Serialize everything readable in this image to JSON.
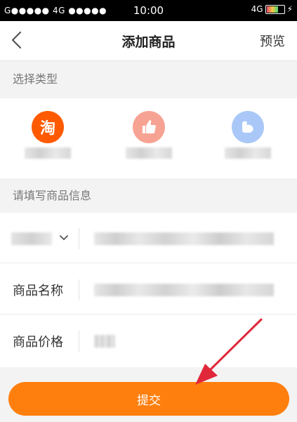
{
  "status_bar": {
    "left": "G●●●●● 4G ●●●●●",
    "time": "10:00",
    "right": "4G"
  },
  "nav": {
    "title": "添加商品",
    "preview": "预览"
  },
  "types_section": {
    "label": "选择类型"
  },
  "types": [
    {
      "icon": "taobao-icon",
      "glyph": "淘",
      "color": "#ff5a00"
    },
    {
      "icon": "thumbs-up-icon",
      "glyph": "👍",
      "color": "#f7a393"
    },
    {
      "icon": "muscle-icon",
      "glyph": "C",
      "color": "#a9c8f7"
    }
  ],
  "info_section": {
    "label": "请填写商品信息"
  },
  "form": {
    "name_label": "商品名称",
    "price_label": "商品价格"
  },
  "submit": {
    "label": "提交"
  },
  "colors": {
    "accent": "#ff7f0e",
    "annotation": "#e0283a"
  }
}
